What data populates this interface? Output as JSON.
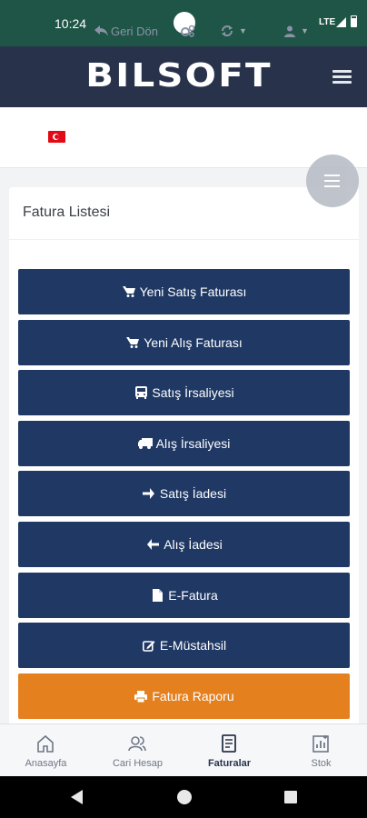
{
  "status_bar": {
    "time": "10:24",
    "network": "LTE"
  },
  "app": {
    "logo_text": "BILSOFT"
  },
  "toolbar": {
    "back_label": "Geri Dön",
    "settings_icon": "gears-icon",
    "refresh_icon": "refresh-icon",
    "user_icon": "user-icon"
  },
  "card": {
    "title": "Fatura Listesi",
    "buttons": [
      {
        "label": "Yeni Satış Faturası",
        "icon": "cart-icon"
      },
      {
        "label": "Yeni Alış Faturası",
        "icon": "cart-icon"
      },
      {
        "label": "Satış İrsaliyesi",
        "icon": "bus-icon"
      },
      {
        "label": "Alış İrsaliyesi",
        "icon": "truck-icon"
      },
      {
        "label": "Satış İadesi",
        "icon": "arrow-right-icon"
      },
      {
        "label": "Alış İadesi",
        "icon": "arrow-left-icon"
      },
      {
        "label": "E-Fatura",
        "icon": "file-icon"
      },
      {
        "label": "E-Müstahsil",
        "icon": "edit-icon"
      },
      {
        "label": "Fatura Raporu",
        "icon": "print-icon"
      }
    ]
  },
  "bottom_nav": {
    "items": [
      {
        "label": "Anasayfa",
        "icon": "home-icon"
      },
      {
        "label": "Cari Hesap",
        "icon": "users-icon"
      },
      {
        "label": "Faturalar",
        "icon": "invoice-icon",
        "active": true
      },
      {
        "label": "Stok",
        "icon": "chart-icon"
      }
    ]
  },
  "colors": {
    "status_bar": "#1f5546",
    "app_bar": "#28334b",
    "button": "#1f3864",
    "accent_button": "#e5801f"
  }
}
